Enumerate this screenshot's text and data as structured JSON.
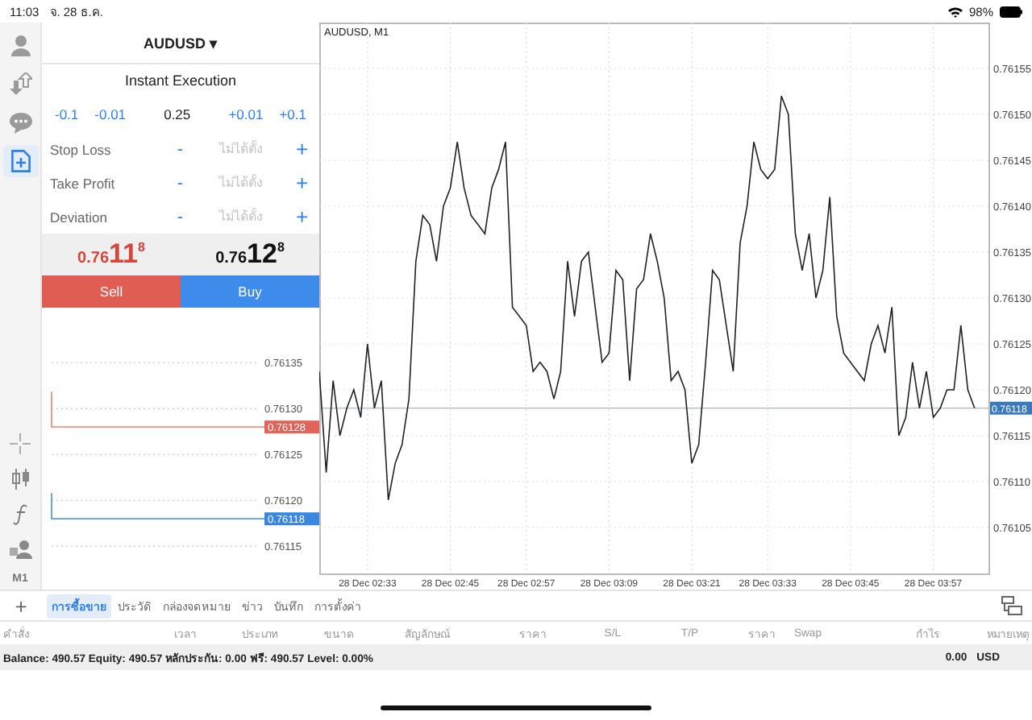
{
  "status_bar": {
    "time": "11:03",
    "date": "จ. 28 ธ.ค.",
    "battery": "98%"
  },
  "sidebar": {
    "items": [
      {
        "kind": "account",
        "selected": false
      },
      {
        "kind": "trade",
        "selected": false
      },
      {
        "kind": "chat",
        "selected": false
      },
      {
        "kind": "new-order",
        "selected": true
      }
    ],
    "tools": [
      {
        "kind": "crosshair"
      },
      {
        "kind": "candles"
      },
      {
        "kind": "function"
      },
      {
        "kind": "objects"
      }
    ],
    "timeframe": "M1"
  },
  "order_panel": {
    "symbol": "AUDUSD",
    "caret": "▾",
    "execution": "Instant Execution",
    "volume_steps": [
      "-0.1",
      "-0.01"
    ],
    "volume": "0.25",
    "volume_steps_up": [
      "+0.01",
      "+0.1"
    ],
    "fields": [
      {
        "label": "Stop Loss",
        "minus": "-",
        "placeholder": "ไม่ได้ตั้ง",
        "plus": "+"
      },
      {
        "label": "Take Profit",
        "minus": "-",
        "placeholder": "ไม่ได้ตั้ง",
        "plus": "+"
      },
      {
        "label": "Deviation",
        "minus": "-",
        "placeholder": "ไม่ได้ตั้ง",
        "plus": "+"
      }
    ],
    "quotes": [
      {
        "kind": "sell",
        "small": "0.76",
        "big": "11",
        "sup": "8",
        "button": "Sell"
      },
      {
        "kind": "buy",
        "small": "0.76",
        "big": "12",
        "sup": "8",
        "button": "Buy"
      }
    ],
    "tick_chart": {
      "axis_labels": [
        "0.76135",
        "0.76130",
        "0.76125",
        "0.76120",
        "0.76115"
      ],
      "bid_tag": "0.76128",
      "ask_tag": "0.76118"
    }
  },
  "chart": {
    "chart_data": {
      "type": "line",
      "title": "AUDUSD, M1",
      "grid": true,
      "ref_lines": [
        {
          "axis": "y",
          "value": 0.76118,
          "label": "0.76118"
        }
      ],
      "categories": [
        null,
        null,
        null,
        null,
        null,
        null,
        null,
        "28 Dec 02:33",
        null,
        null,
        null,
        null,
        null,
        null,
        null,
        null,
        null,
        null,
        null,
        "28 Dec 02:45",
        null,
        null,
        null,
        null,
        null,
        null,
        null,
        null,
        null,
        null,
        "28 Dec 02:57",
        null,
        null,
        null,
        null,
        null,
        null,
        null,
        null,
        null,
        null,
        null,
        "28 Dec 03:09",
        null,
        null,
        null,
        null,
        null,
        null,
        null,
        null,
        null,
        null,
        null,
        "28 Dec 03:21",
        null,
        null,
        null,
        null,
        null,
        null,
        null,
        null,
        null,
        null,
        "28 Dec 03:33",
        null,
        null,
        null,
        null,
        null,
        null,
        null,
        null,
        null,
        null,
        null,
        "28 Dec 03:45",
        null,
        null,
        null,
        null,
        null,
        null,
        null,
        null,
        null,
        null,
        null,
        "28 Dec 03:57",
        null,
        null,
        null,
        null,
        null,
        null
      ],
      "series": [
        {
          "color": "#222222",
          "values": [
            0.76122,
            0.76111,
            0.76121,
            0.76115,
            0.76118,
            0.7612,
            0.76117,
            0.76125,
            0.76118,
            0.76121,
            0.76108,
            0.76112,
            0.76114,
            0.76119,
            0.76134,
            0.76139,
            0.76138,
            0.76134,
            0.7614,
            0.76142,
            0.76147,
            0.76142,
            0.76139,
            0.76138,
            0.76137,
            0.76142,
            0.76144,
            0.76147,
            0.76129,
            0.76128,
            0.76127,
            0.76122,
            0.76123,
            0.76122,
            0.76119,
            0.76122,
            0.76134,
            0.76128,
            0.76134,
            0.76135,
            0.76129,
            0.76123,
            0.76124,
            0.76133,
            0.76132,
            0.76121,
            0.76131,
            0.76132,
            0.76137,
            0.76134,
            0.7613,
            0.76121,
            0.76122,
            0.7612,
            0.76112,
            0.76114,
            0.76123,
            0.76133,
            0.76132,
            0.76127,
            0.76122,
            0.76136,
            0.7614,
            0.76147,
            0.76144,
            0.76143,
            0.76144,
            0.76152,
            0.7615,
            0.76137,
            0.76133,
            0.76137,
            0.7613,
            0.76133,
            0.76141,
            0.76128,
            0.76124,
            0.76123,
            0.76122,
            0.76121,
            0.76125,
            0.76127,
            0.76124,
            0.76129,
            0.76115,
            0.76117,
            0.76123,
            0.76118,
            0.76122,
            0.76117,
            0.76118,
            0.7612,
            0.7612,
            0.76127,
            0.7612,
            0.76118
          ]
        }
      ],
      "ylim": [
        0.761,
        0.7616
      ],
      "yticks": [
        {
          "value": 0.76105,
          "label": "0.76105"
        },
        {
          "value": 0.7611,
          "label": "0.76110"
        },
        {
          "value": 0.76115,
          "label": "0.76115"
        },
        {
          "value": 0.7612,
          "label": "0.76120"
        },
        {
          "value": 0.76125,
          "label": "0.76125"
        },
        {
          "value": 0.7613,
          "label": "0.76130"
        },
        {
          "value": 0.76135,
          "label": "0.76135"
        },
        {
          "value": 0.7614,
          "label": "0.76140"
        },
        {
          "value": 0.76145,
          "label": "0.76145"
        },
        {
          "value": 0.7615,
          "label": "0.76150"
        },
        {
          "value": 0.76155,
          "label": "0.76155"
        }
      ]
    }
  },
  "toolbar": {
    "add": "+",
    "tabs": [
      {
        "label": "การซื้อขาย",
        "selected": true
      },
      {
        "label": "ประวัติ",
        "selected": false
      },
      {
        "label": "กล่องจดหมาย",
        "selected": false
      },
      {
        "label": "ข่าว",
        "selected": false
      },
      {
        "label": "บันทึก",
        "selected": false
      },
      {
        "label": "การตั้งค่า",
        "selected": false
      }
    ]
  },
  "table": {
    "columns": [
      "คำสั่ง",
      "เวลา",
      "ประเภท",
      "ขนาด",
      "สัญลักษณ์",
      "ราคา",
      "S/L",
      "T/P",
      "ราคา",
      "Swap",
      "กำไร",
      "หมายเหตุ"
    ]
  },
  "summary": {
    "text": "Balance: 490.57 Equity: 490.57 หลักประกัน: 0.00 ฟรี: 490.57 Level: 0.00%",
    "profit": "0.00",
    "currency": "USD"
  }
}
